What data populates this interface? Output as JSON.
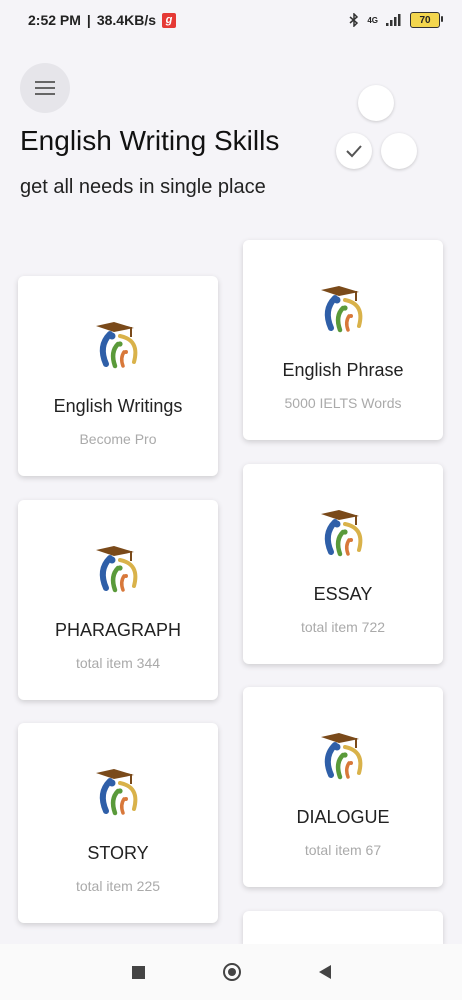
{
  "status_bar": {
    "time": "2:52 PM",
    "speed": "38.4KB/s",
    "badge": "g",
    "network": "4G",
    "battery": "70"
  },
  "header": {
    "title": "English Writing Skills",
    "subtitle": "get all needs in single place"
  },
  "cards": [
    {
      "title": "English Writings",
      "subtitle": "Become Pro"
    },
    {
      "title": "English Phrase",
      "subtitle": "5000 IELTS Words"
    },
    {
      "title": "PHARAGRAPH",
      "subtitle": "total item 344"
    },
    {
      "title": "ESSAY",
      "subtitle": "total item 722"
    },
    {
      "title": "STORY",
      "subtitle": "total item 225"
    },
    {
      "title": "DIALOGUE",
      "subtitle": "total item 67"
    }
  ],
  "colors": {
    "background": "#f5f4f8",
    "logo_blue": "#2f5fa8",
    "logo_green": "#5a9a3a",
    "logo_orange": "#d8783a",
    "logo_gold": "#d9b24a",
    "logo_cap": "#7a4a1a"
  }
}
